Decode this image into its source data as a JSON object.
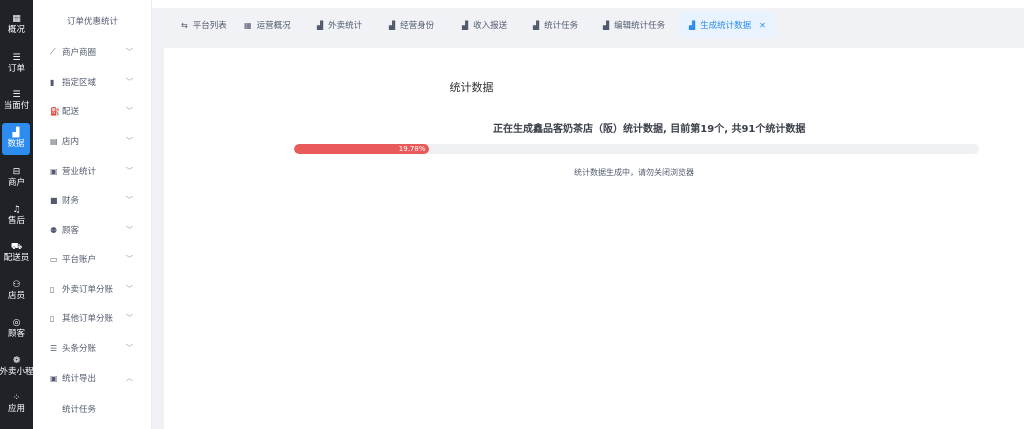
{
  "rail": [
    {
      "icon": "▦",
      "label": "概况",
      "icon_name": "overview-icon"
    },
    {
      "icon": "☰",
      "label": "订单",
      "icon_name": "order-list-icon"
    },
    {
      "icon": "☰",
      "label": "当面付",
      "icon_name": "face-pay-icon"
    },
    {
      "icon": "▟",
      "label": "数据",
      "icon_name": "data-chart-icon"
    },
    {
      "icon": "⊟",
      "label": "商户",
      "icon_name": "merchant-icon"
    },
    {
      "icon": "♫",
      "label": "售后",
      "icon_name": "headset-icon"
    },
    {
      "icon": "⛟",
      "label": "配送员",
      "icon_name": "courier-icon"
    },
    {
      "icon": "⚇",
      "label": "店员",
      "icon_name": "staff-icon"
    },
    {
      "icon": "◎",
      "label": "顾客",
      "icon_name": "customer-icon"
    },
    {
      "icon": "❁",
      "label": "外卖小程",
      "icon_name": "miniapp-icon"
    },
    {
      "icon": "⁘",
      "label": "应用",
      "icon_name": "apps-icon"
    }
  ],
  "rail_active_index": 3,
  "sidebar": {
    "title": "订单优惠统计",
    "items": [
      {
        "icon": "⟋",
        "label": "商户商圈",
        "icon_name": "trend-icon"
      },
      {
        "icon": "▮",
        "label": "指定区域",
        "icon_name": "bar-chart-icon"
      },
      {
        "icon": "⛽",
        "label": "配送",
        "icon_name": "delivery-icon"
      },
      {
        "icon": "▤",
        "label": "店内",
        "icon_name": "store-icon"
      },
      {
        "icon": "▣",
        "label": "营业统计",
        "icon_name": "business-icon"
      },
      {
        "icon": "■",
        "label": "财务",
        "icon_name": "finance-icon"
      },
      {
        "icon": "⚉",
        "label": "顾客",
        "icon_name": "customer-group-icon"
      },
      {
        "icon": "▭",
        "label": "平台账户",
        "icon_name": "account-icon"
      },
      {
        "icon": "▯",
        "label": "外卖订单分账",
        "icon_name": "split-icon"
      },
      {
        "icon": "▯",
        "label": "其他订单分账",
        "icon_name": "split-other-icon"
      },
      {
        "icon": "☰",
        "label": "头条分账",
        "icon_name": "headline-icon"
      },
      {
        "icon": "▣",
        "label": "统计导出",
        "icon_name": "export-icon"
      }
    ],
    "sub_item": "统计任务"
  },
  "tabs": [
    {
      "icon": "⇆",
      "label": "平台列表",
      "icon_name": "platform-list-icon"
    },
    {
      "icon": "▦",
      "label": "运营概况",
      "icon_name": "operation-icon"
    },
    {
      "icon": "▟",
      "label": "外卖统计",
      "icon_name": "takeout-chart-icon"
    },
    {
      "icon": "▟",
      "label": "经营身份",
      "icon_name": "identity-chart-icon"
    },
    {
      "icon": "▟",
      "label": "收入报送",
      "icon_name": "income-chart-icon"
    },
    {
      "icon": "▟",
      "label": "统计任务",
      "icon_name": "task-chart-icon"
    },
    {
      "icon": "▟",
      "label": "编辑统计任务",
      "icon_name": "edit-task-chart-icon"
    },
    {
      "icon": "▟",
      "label": "生成统计数据",
      "icon_name": "generate-chart-icon"
    }
  ],
  "main": {
    "title": "统计数据",
    "status_text": "正在生成鑫品客奶茶店（阪）统计数据, 目前第19个, 共91个统计数据",
    "progress_percent": 19.78,
    "progress_label": "19.78%",
    "hint": "统计数据生成中，请勿关闭浏览器"
  },
  "colors": {
    "accent": "#2d8cf0",
    "progress": "#e95b5b",
    "rail_bg": "#1f2328"
  }
}
